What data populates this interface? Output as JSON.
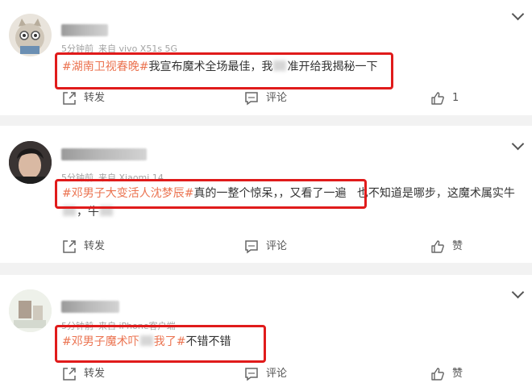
{
  "comments": [
    {
      "meta_time": "5分钟前",
      "meta_source": "来自 vivo X51s 5G",
      "hashtag": "#湖南卫视春晚#",
      "text_a": "我宣布魔术全场最佳，我",
      "text_b": "准开给我揭秘一下",
      "actions": {
        "repost": "转发",
        "comment": "评论",
        "like": "1"
      }
    },
    {
      "meta_time": "5分钟前",
      "meta_source": "来自 Xiaomi 14",
      "hashtag": "#邓男子大变活人沈梦辰#",
      "text_a": "真的一整个惊呆，，又看了一遍",
      "text_b": "也不知道是哪步，这魔术属实牛",
      "text_c": "，牛",
      "actions": {
        "repost": "转发",
        "comment": "评论",
        "like": "赞"
      }
    },
    {
      "meta_time": "5分钟前",
      "meta_source": "来自 iPhone客户端",
      "hashtag_a": "#邓男子魔术吓",
      "hashtag_b": "我了#",
      "text_a": "不错不错",
      "actions": {
        "repost": "转发",
        "comment": "评论",
        "like": "赞"
      }
    }
  ],
  "icons": {
    "repost": "share-icon",
    "comment": "comment-icon",
    "like": "thumbs-up-icon",
    "more": "chevron-down-icon"
  },
  "colors": {
    "hashtag": "#eb7350",
    "highlight_box": "#e01b1b"
  }
}
